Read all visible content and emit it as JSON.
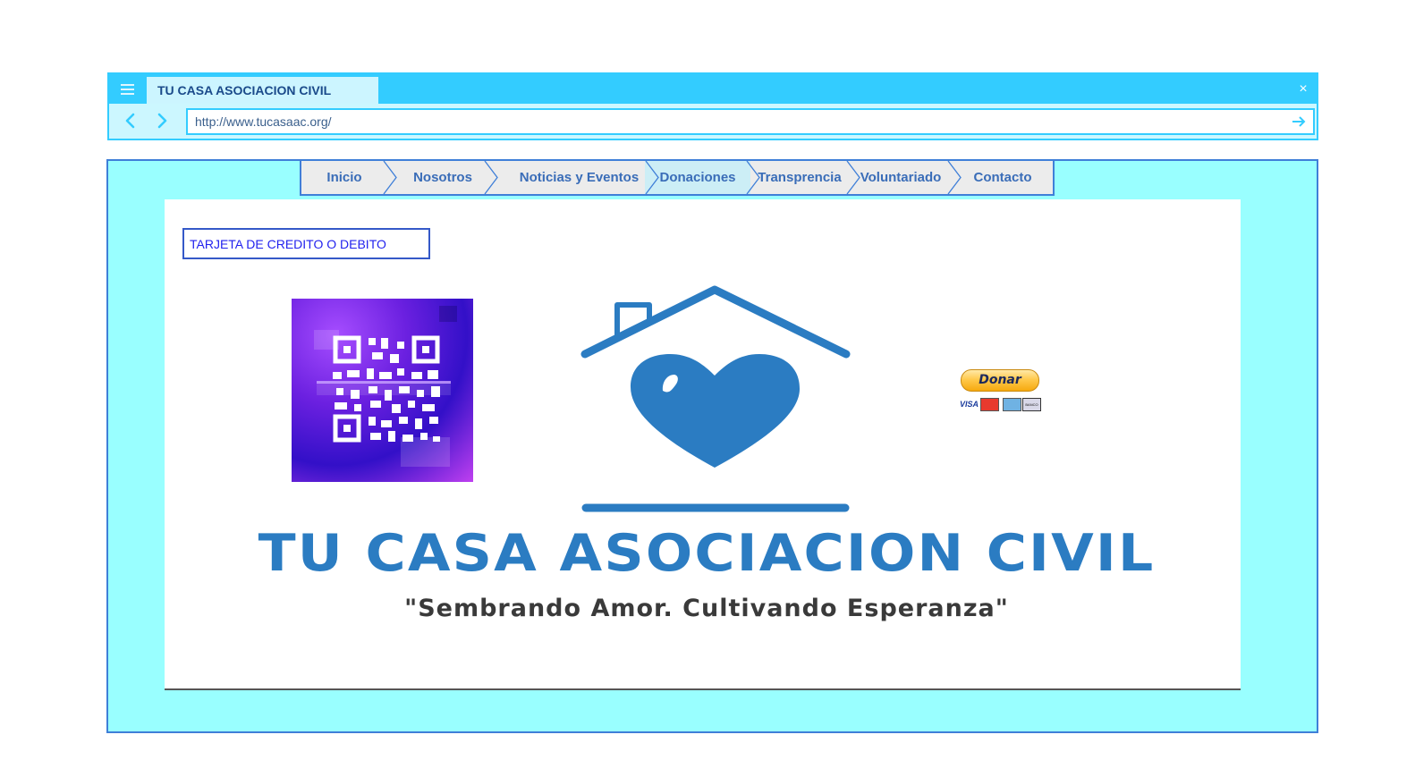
{
  "browser": {
    "tab_title": "TU CASA ASOCIACION CIVIL",
    "url": "http://www.tucasaac.org/",
    "close_label": "×"
  },
  "nav": {
    "items": [
      {
        "label": "Inicio"
      },
      {
        "label": "Nosotros"
      },
      {
        "label": "Noticias y Eventos"
      },
      {
        "label": "Donaciones",
        "active": true
      },
      {
        "label": "Transprencia"
      },
      {
        "label": "Voluntariado"
      },
      {
        "label": "Contacto"
      }
    ]
  },
  "content": {
    "card_link": "TARJETA DE CREDITO O DEBITO",
    "logo_title": "TU CASA ASOCIACION CIVIL",
    "logo_slogan": "\"Sembrando Amor. Cultivando Esperanza\"",
    "donate_button": "Donar",
    "card_visa": "VISA",
    "card_bank": "BANCO"
  },
  "colors": {
    "chrome_accent": "#33ccff",
    "page_background": "#99ffff",
    "nav_text": "#3a6db8",
    "logo_blue": "#2b7cc2"
  },
  "icons": [
    "menu-icon",
    "close-icon",
    "back-arrow-icon",
    "forward-arrow-icon",
    "go-arrow-icon",
    "house-heart-logo-icon",
    "qr-code-icon"
  ]
}
